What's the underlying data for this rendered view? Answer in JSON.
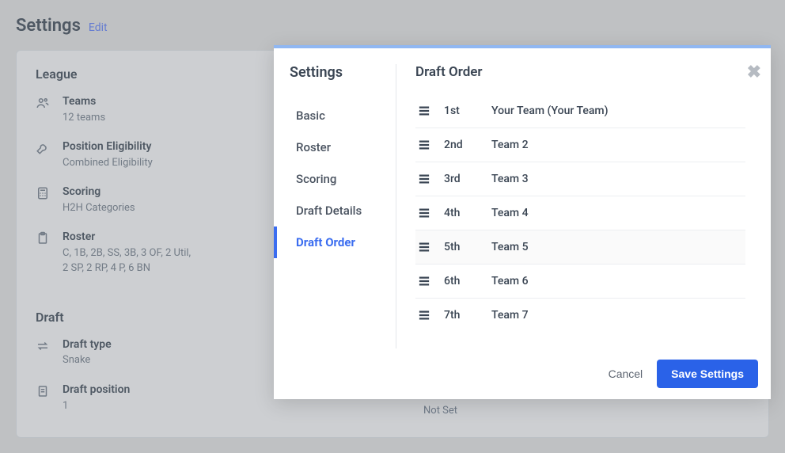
{
  "page": {
    "title": "Settings",
    "edit": "Edit",
    "not_set": "Not Set"
  },
  "league": {
    "section_title": "League",
    "teams": {
      "label": "Teams",
      "value": "12 teams"
    },
    "eligibility": {
      "label": "Position Eligibility",
      "value": "Combined Eligibility"
    },
    "scoring": {
      "label": "Scoring",
      "value": "H2H Categories"
    },
    "roster": {
      "label": "Roster",
      "line1": "C, 1B, 2B, SS, 3B, 3 OF, 2 Util,",
      "line2": "2 SP, 2 RP, 4 P, 6 BN"
    }
  },
  "draft": {
    "section_title": "Draft",
    "type": {
      "label": "Draft type",
      "value": "Snake"
    },
    "position": {
      "label": "Draft position",
      "value": "1"
    }
  },
  "modal": {
    "sidebar_title": "Settings",
    "tabs": {
      "basic": "Basic",
      "roster": "Roster",
      "scoring": "Scoring",
      "draft_details": "Draft Details",
      "draft_order": "Draft Order"
    },
    "content_title": "Draft Order",
    "order": [
      {
        "pos": "1st",
        "team": "Your Team (Your Team)"
      },
      {
        "pos": "2nd",
        "team": "Team 2"
      },
      {
        "pos": "3rd",
        "team": "Team 3"
      },
      {
        "pos": "4th",
        "team": "Team 4"
      },
      {
        "pos": "5th",
        "team": "Team 5"
      },
      {
        "pos": "6th",
        "team": "Team 6"
      },
      {
        "pos": "7th",
        "team": "Team 7"
      }
    ],
    "cancel": "Cancel",
    "save": "Save Settings"
  }
}
